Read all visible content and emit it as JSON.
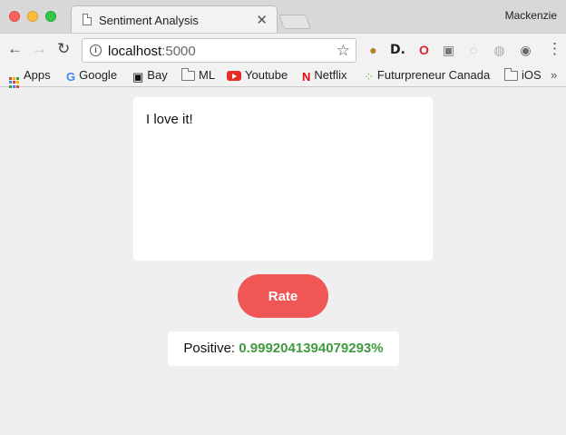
{
  "browser": {
    "tab_title": "Sentiment Analysis",
    "profile_name": "Mackenzie",
    "url_host": "localhost",
    "url_port": ":5000",
    "bookmarks": [
      {
        "label": "Apps",
        "icon": "apps-grid-icon"
      },
      {
        "label": "Google",
        "icon": "google-icon"
      },
      {
        "label": "Bay",
        "icon": "bay-icon"
      },
      {
        "label": "ML",
        "icon": "folder-icon"
      },
      {
        "label": "Youtube",
        "icon": "youtube-icon"
      },
      {
        "label": "Netflix",
        "icon": "netflix-icon"
      },
      {
        "label": "Futurpreneur Canada",
        "icon": "futurpreneur-icon"
      },
      {
        "label": "iOS",
        "icon": "folder-icon"
      }
    ],
    "overflow_label": "»"
  },
  "app": {
    "input_text": "I love it!",
    "rate_label": "Rate",
    "result_label": "Positive:",
    "result_score": "0.9992041394079293%"
  },
  "colors": {
    "rate_button": "#f05656",
    "positive_score": "#3f9a3f",
    "page_background": "#efefef"
  }
}
